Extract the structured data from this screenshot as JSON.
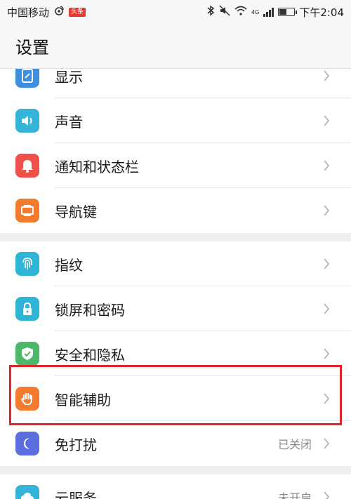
{
  "status_bar": {
    "carrier": "中国移动",
    "badge": "头条",
    "network": "4G",
    "time": "下午2:04",
    "battery_level": 0.55
  },
  "header": {
    "title": "设置"
  },
  "groups": [
    {
      "items": [
        {
          "label": "显示",
          "icon": "display-icon",
          "color": "#3d8fe0"
        },
        {
          "label": "声音",
          "icon": "speaker-icon",
          "color": "#35b3d8"
        },
        {
          "label": "通知和状态栏",
          "icon": "bell-icon",
          "color": "#f0504a"
        },
        {
          "label": "导航键",
          "icon": "navigation-key-icon",
          "color": "#f27b2d"
        }
      ]
    },
    {
      "items": [
        {
          "label": "指纹",
          "icon": "fingerprint-icon",
          "color": "#2fb5d6"
        },
        {
          "label": "锁屏和密码",
          "icon": "lock-icon",
          "color": "#2fb5d6"
        },
        {
          "label": "安全和隐私",
          "icon": "shield-icon",
          "color": "#4cb86a"
        },
        {
          "label": "智能辅助",
          "icon": "hand-icon",
          "color": "#f27b2d"
        },
        {
          "label": "免打扰",
          "icon": "moon-icon",
          "color": "#5b6ee0",
          "value": "已关闭"
        }
      ]
    },
    {
      "items": [
        {
          "label": "云服务",
          "icon": "cloud-icon",
          "color": "#35b3d8",
          "value": "未开启"
        }
      ]
    }
  ]
}
